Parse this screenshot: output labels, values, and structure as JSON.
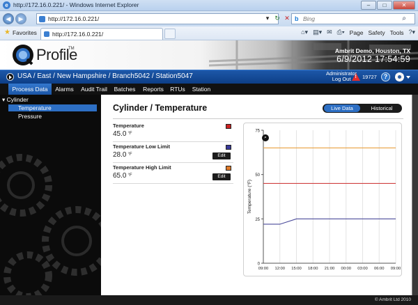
{
  "browser": {
    "title": "http://172.16.0.221/ - Windows Internet Explorer",
    "url": "http://172.16.0.221/",
    "search_placeholder": "Bing",
    "favorites_label": "Favorites",
    "tab_label": "http://172.16.0.221/",
    "commands": [
      "Page",
      "Safety",
      "Tools"
    ]
  },
  "header": {
    "logo_text": "Profile",
    "logo_tm": "TM",
    "site_name": "Ambrit Demo, Houston, TX",
    "datetime": "6/9/2012  17:54:59"
  },
  "breadcrumb": {
    "path": "USA / East / New Hampshire / Branch5042 / Station5047",
    "user_name": "Administrator",
    "logout_label": "Log Out",
    "alarm_count": "19727"
  },
  "nav": {
    "items": [
      "Process Data",
      "Alarms",
      "Audit Trail",
      "Batches",
      "Reports",
      "RTUs",
      "Station"
    ]
  },
  "sidebar": {
    "category": "Cylinder",
    "items": [
      "Temperature",
      "Pressure"
    ]
  },
  "main": {
    "title": "Cylinder / Temperature",
    "toggle_live": "Live Data",
    "toggle_historical": "Historical",
    "edit_label": "Edit",
    "points": [
      {
        "label": "Temperature",
        "value": "45.0",
        "unit": "°F",
        "color": "#cc2222"
      },
      {
        "label": "Temperature Low Limit",
        "value": "28.0",
        "unit": "°F",
        "color": "#3a3a9a"
      },
      {
        "label": "Temperature High Limit",
        "value": "65.0",
        "unit": "°F",
        "color": "#e07b2a"
      }
    ]
  },
  "chart_data": {
    "type": "line",
    "title": "",
    "xlabel": "",
    "ylabel": "Temperature (°F)",
    "ylim": [
      0,
      75
    ],
    "yticks": [
      0,
      25,
      50,
      75
    ],
    "categories": [
      "09:00",
      "12:00",
      "15:00",
      "18:00",
      "21:00",
      "00:00",
      "03:00",
      "06:00",
      "09:00"
    ],
    "series": [
      {
        "color": "#e8a040",
        "values": [
          65,
          65,
          65,
          65,
          65,
          65,
          65,
          65,
          65
        ]
      },
      {
        "color": "#d04040",
        "values": [
          45,
          45,
          45,
          45,
          45,
          45,
          45,
          45,
          45
        ]
      },
      {
        "color": "#4a4a9a",
        "values": [
          22,
          22,
          25,
          25,
          25,
          25,
          25,
          25,
          25
        ]
      }
    ],
    "grid": "vertical"
  },
  "footer": {
    "copyright": "© Ambrit Ltd 2010"
  }
}
